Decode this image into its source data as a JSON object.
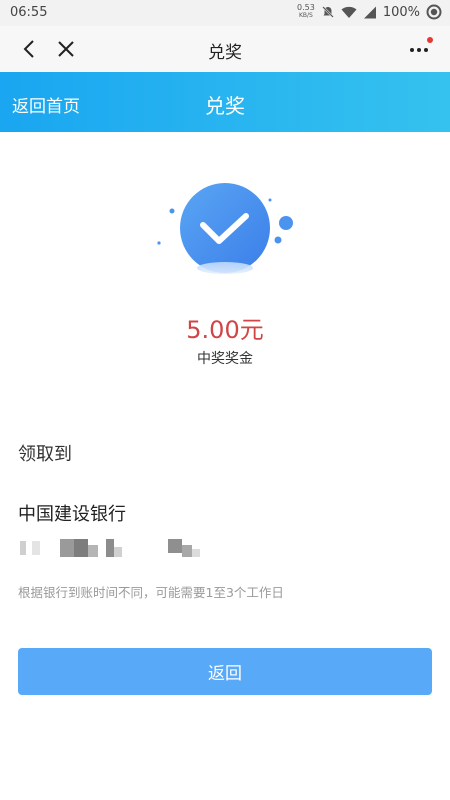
{
  "status_bar": {
    "time": "06:55",
    "net_speed_value": "0.53",
    "net_speed_unit": "KB/S",
    "battery": "100%",
    "icons": [
      "mute-icon",
      "wifi-icon",
      "signal-icon",
      "battery-icon"
    ]
  },
  "titlebar": {
    "title": "兑奖",
    "icons": [
      "back-icon",
      "close-icon",
      "more-icon"
    ],
    "notification_dot_color": "#e53935"
  },
  "header": {
    "home_link": "返回首页",
    "title": "兑奖",
    "gradient": [
      "#1aa6f0",
      "#35c2ef"
    ]
  },
  "result": {
    "icon": "check-circle-icon",
    "amount": "5.00元",
    "amount_color": "#d04545",
    "label": "中奖奖金"
  },
  "receive": {
    "label": "领取到",
    "bank": "中国建设银行",
    "note": "根据银行到账时间不同，可能需要1至3个工作日"
  },
  "actions": {
    "return_label": "返回",
    "button_color": "#58a9f8"
  }
}
